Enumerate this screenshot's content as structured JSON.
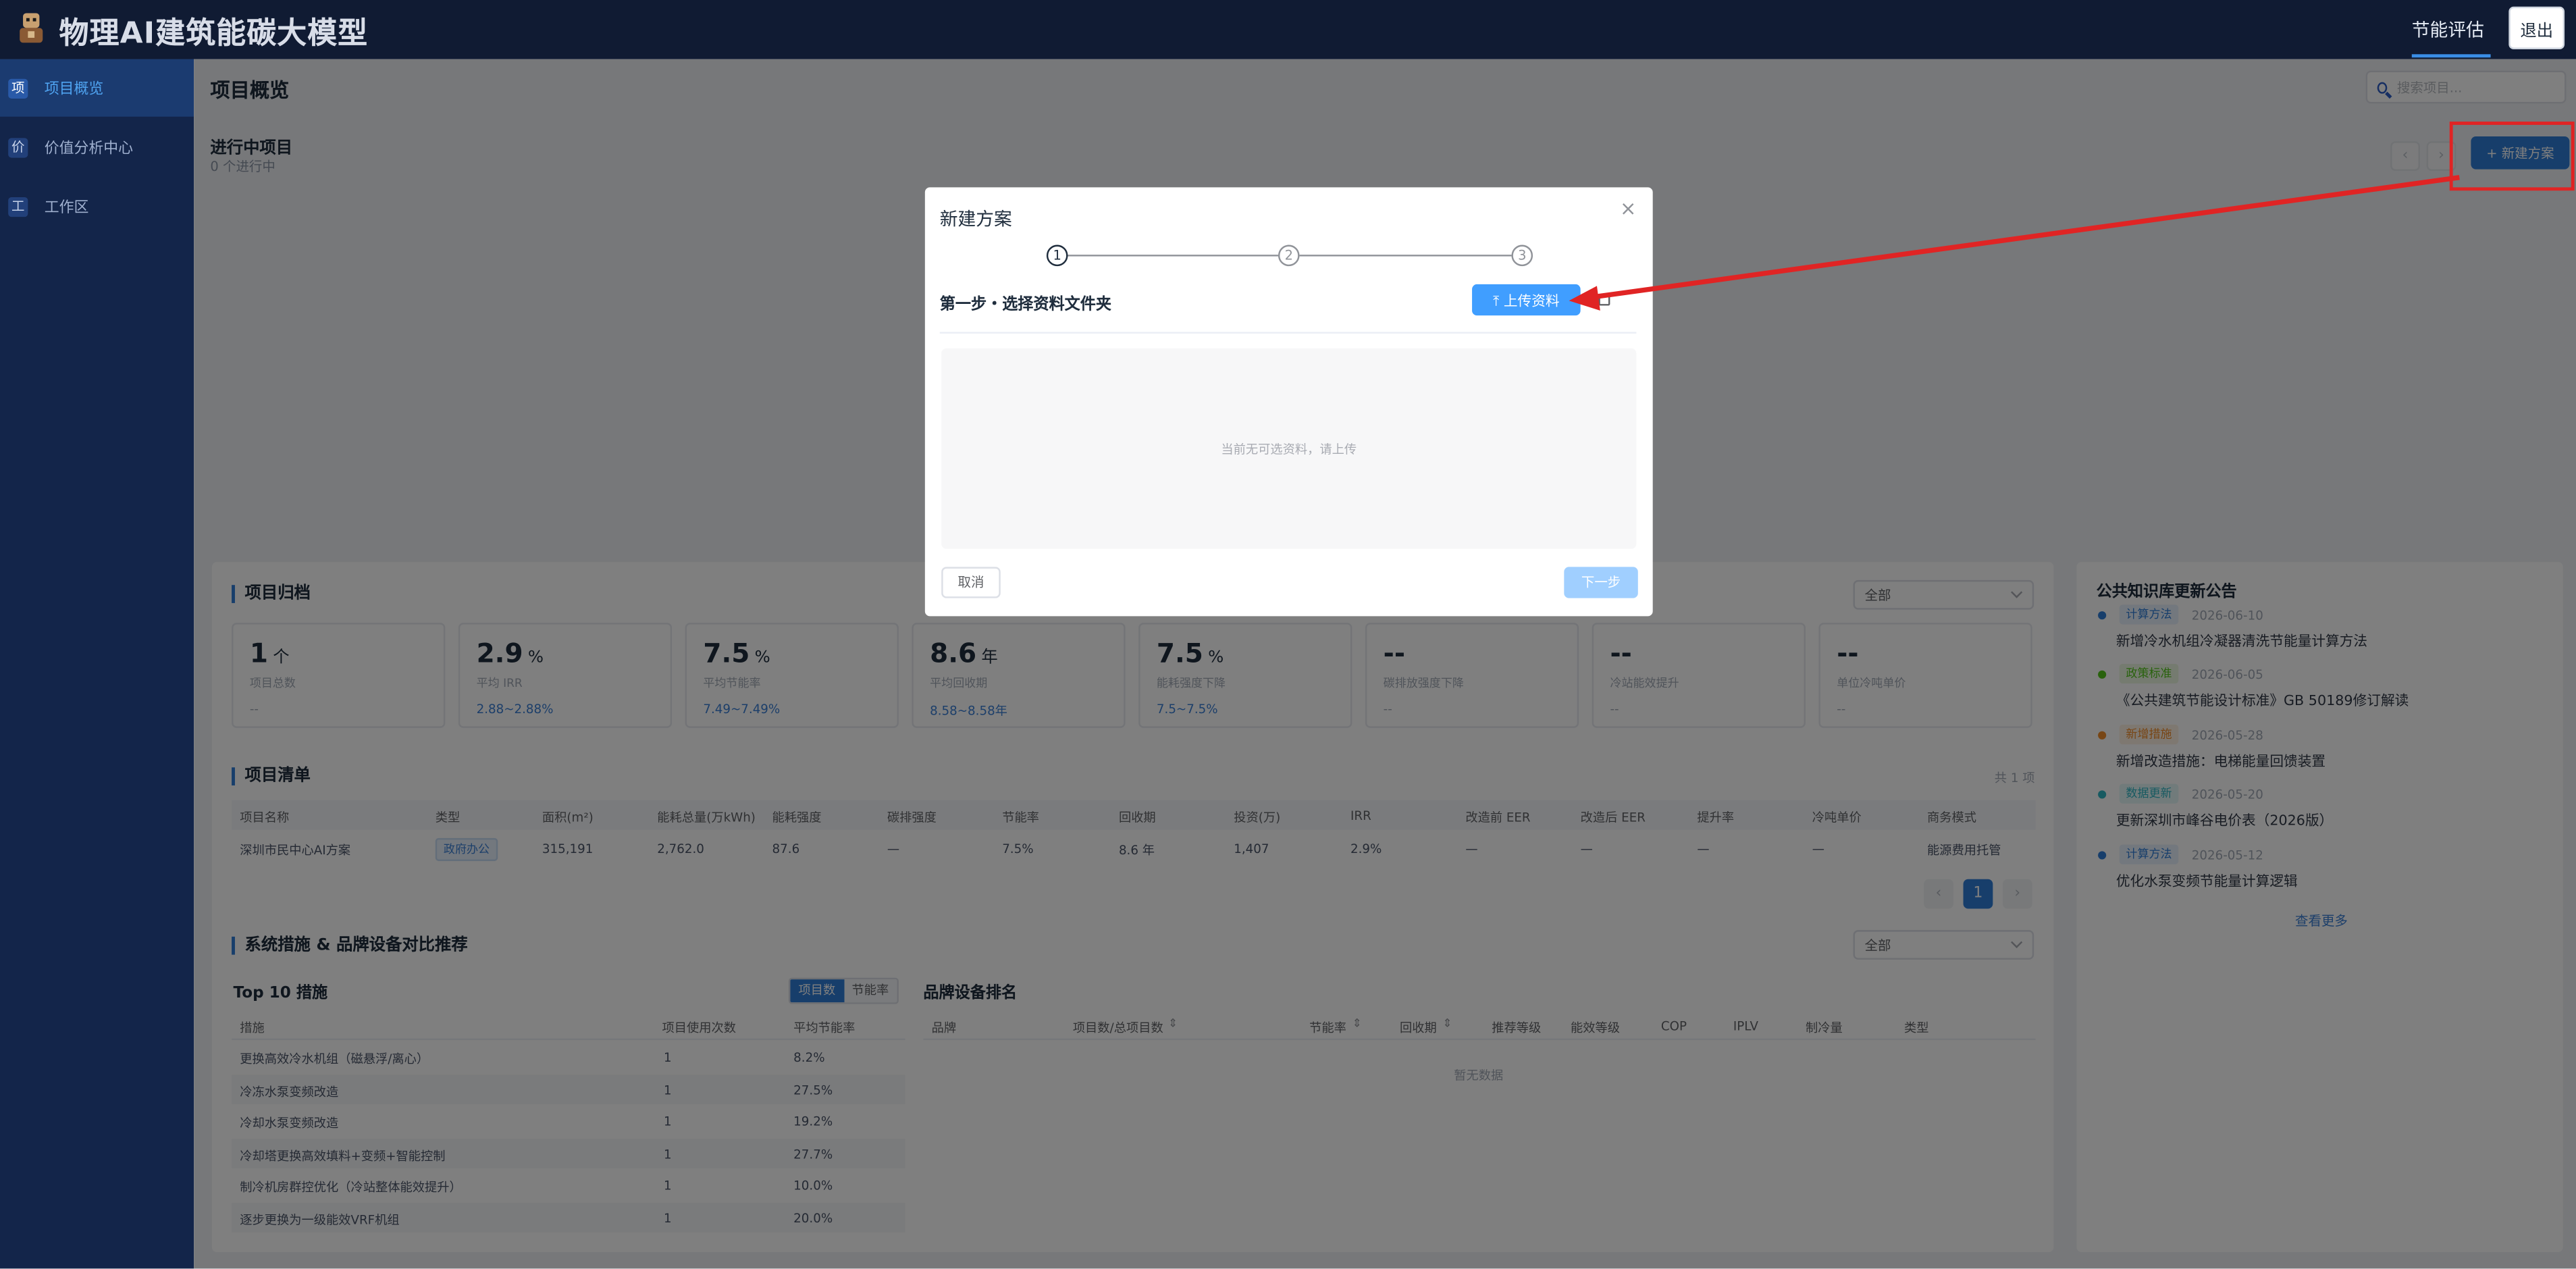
{
  "header": {
    "title": "物理AI建筑能碳大模型",
    "nav_tab": "节能评估",
    "logout": "退出"
  },
  "sidebar": {
    "items": [
      {
        "icon_char": "项",
        "label": "项目概览",
        "active": true
      },
      {
        "icon_char": "价",
        "label": "价值分析中心",
        "active": false
      },
      {
        "icon_char": "工",
        "label": "工作区",
        "active": false
      }
    ]
  },
  "page": {
    "title": "项目概览",
    "search_placeholder": "搜索项目...",
    "ongoing_title": "进行中项目",
    "ongoing_count": "0 个进行中",
    "pager_prev": "‹",
    "pager_next": "›",
    "new_plan": "+ 新建方案"
  },
  "archive": {
    "title": "项目归档",
    "filter": "全部",
    "stats": [
      {
        "value": "1",
        "unit": "个",
        "label": "项目总数",
        "range": "--"
      },
      {
        "value": "2.9",
        "unit": "%",
        "label": "平均 IRR",
        "range": "2.88~2.88%"
      },
      {
        "value": "7.5",
        "unit": "%",
        "label": "平均节能率",
        "range": "7.49~7.49%"
      },
      {
        "value": "8.6",
        "unit": "年",
        "label": "平均回收期",
        "range": "8.58~8.58年"
      },
      {
        "value": "7.5",
        "unit": "%",
        "label": "能耗强度下降",
        "range": "7.5~7.5%"
      },
      {
        "value": "--",
        "unit": "",
        "label": "碳排放强度下降",
        "range": "--"
      },
      {
        "value": "--",
        "unit": "",
        "label": "冷站能效提升",
        "range": "--"
      },
      {
        "value": "--",
        "unit": "",
        "label": "单位冷吨单价",
        "range": "--"
      }
    ]
  },
  "project_list": {
    "title": "项目清单",
    "total": "共 1 项",
    "headers": [
      "项目名称",
      "类型",
      "面积(m²)",
      "能耗总量(万kWh)",
      "能耗强度",
      "碳排强度",
      "节能率",
      "回收期",
      "投资(万)",
      "IRR",
      "改造前 EER",
      "改造后 EER",
      "提升率",
      "冷吨单价",
      "商务模式"
    ],
    "rows": [
      [
        "深圳市民中心AI方案",
        "政府办公",
        "315,191",
        "2,762.0",
        "87.6",
        "—",
        "7.5%",
        "8.6 年",
        "1,407",
        "2.9%",
        "—",
        "—",
        "—",
        "—",
        "能源费用托管"
      ]
    ],
    "pager": {
      "prev": "‹",
      "current": "1",
      "next": "›"
    }
  },
  "measures": {
    "title": "系统措施 & 品牌设备对比推荐",
    "filter": "全部",
    "top10_title": "Top 10 措施",
    "toggle": [
      "项目数",
      "节能率"
    ],
    "headers": [
      "措施",
      "项目使用次数",
      "平均节能率"
    ],
    "rows": [
      [
        "更换高效冷水机组（磁悬浮/离心）",
        "1",
        "8.2%"
      ],
      [
        "冷冻水泵变频改造",
        "1",
        "27.5%"
      ],
      [
        "冷却水泵变频改造",
        "1",
        "19.2%"
      ],
      [
        "冷却塔更换高效填料+变频+智能控制",
        "1",
        "27.7%"
      ],
      [
        "制冷机房群控优化（冷站整体能效提升）",
        "1",
        "10.0%"
      ],
      [
        "逐步更换为一级能效VRF机组",
        "1",
        "20.0%"
      ]
    ],
    "brand_title": "品牌设备排名",
    "brand_headers": [
      "品牌",
      "项目数/总项目数",
      "节能率",
      "回收期",
      "推荐等级",
      "能效等级",
      "COP",
      "IPLV",
      "制冷量",
      "类型"
    ],
    "brand_empty": "暂无数据"
  },
  "news": {
    "title": "公共知识库更新公告",
    "items": [
      {
        "tag": "计算方法",
        "date": "2026-06-10",
        "title": "新增冷水机组冷凝器清洗节能量计算方法",
        "color": "#2f7dd6",
        "tag_bg": "#e6f0fc"
      },
      {
        "tag": "政策标准",
        "date": "2026-06-05",
        "title": "《公共建筑节能设计标准》GB 50189修订解读",
        "color": "#52c41a",
        "tag_bg": "#eaf7e1"
      },
      {
        "tag": "新增措施",
        "date": "2026-05-28",
        "title": "新增改造措施：电梯能量回馈装置",
        "color": "#f08c2a",
        "tag_bg": "#fdf0e2"
      },
      {
        "tag": "数据更新",
        "date": "2026-05-20",
        "title": "更新深圳市峰谷电价表（2026版）",
        "color": "#2fb5c2",
        "tag_bg": "#e3f6f7"
      },
      {
        "tag": "计算方法",
        "date": "2026-05-12",
        "title": "优化水泵变频节能量计算逻辑",
        "color": "#2f7dd6",
        "tag_bg": "#e6f0fc"
      }
    ],
    "more": "查看更多"
  },
  "modal": {
    "title": "新建方案",
    "close": "×",
    "steps": [
      "1",
      "2",
      "3"
    ],
    "step_title": "第一步・选择资料文件夹",
    "upload": "⤒ 上传资料",
    "empty_text": "当前无可选资料，请上传",
    "cancel": "取消",
    "next": "下一步"
  },
  "colors": {
    "header_bg": "#101b33",
    "sidebar_bg": "#13254a",
    "primary": "#2f7dd6",
    "annotation_red": "#e02424"
  }
}
